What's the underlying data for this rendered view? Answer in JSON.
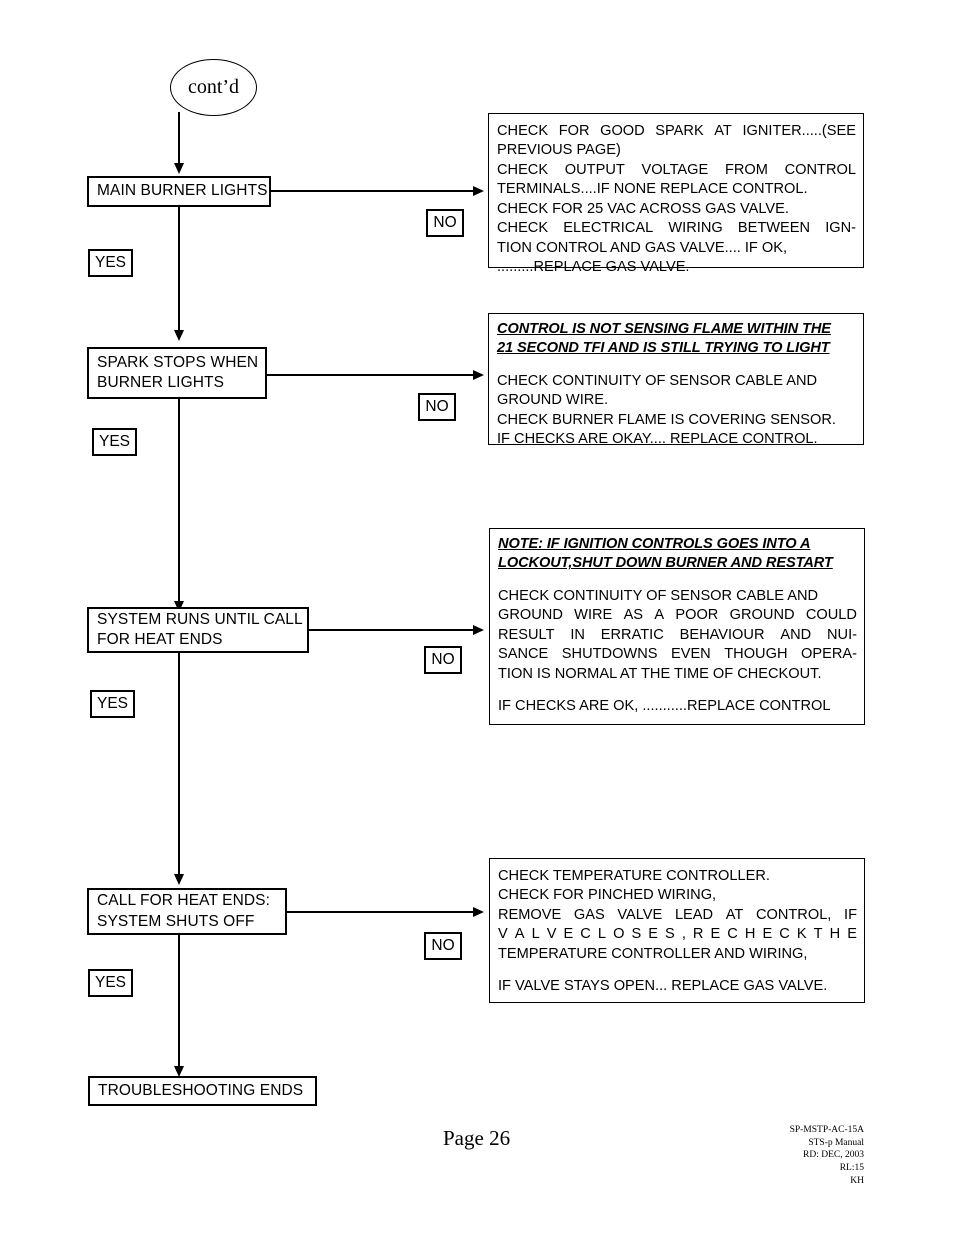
{
  "document": {
    "page_label": "Page 26",
    "meta_lines": [
      "SP-MSTP-AC-15A",
      "STS-p Manual",
      "RD: DEC, 2003",
      "RL:15",
      "KH"
    ]
  },
  "flow": {
    "start_node": {
      "label": "cont’d"
    },
    "steps": [
      {
        "id": "main-burner-lights",
        "lines": [
          "MAIN BURNER LIGHTS"
        ],
        "yes_label": "YES",
        "no_label": "NO"
      },
      {
        "id": "spark-stops-when-burner-lights",
        "lines": [
          "SPARK STOPS WHEN",
          "BURNER LIGHTS"
        ],
        "yes_label": "YES",
        "no_label": "NO"
      },
      {
        "id": "system-runs-until-call-for-heat-ends",
        "lines": [
          "SYSTEM RUNS UNTIL CALL",
          "FOR HEAT ENDS"
        ],
        "yes_label": "YES",
        "no_label": "NO"
      },
      {
        "id": "call-for-heat-ends-system-shuts-off",
        "lines": [
          "CALL FOR HEAT ENDS:",
          "SYSTEM SHUTS OFF"
        ],
        "yes_label": "YES",
        "no_label": "NO"
      }
    ],
    "end_node": {
      "label": "TROUBLESHOOTING ENDS"
    }
  },
  "panels": [
    {
      "id": "spark-igniter-checks",
      "header": null,
      "header2": null,
      "lines": [
        {
          "text": "CHECK  FOR  GOOD  SPARK  AT  IGNITER.....(SEE",
          "justify": true,
          "words": [
            "CHECK",
            "FOR",
            "GOOD",
            "SPARK",
            "AT",
            "IGNITER.....(SEE"
          ]
        },
        {
          "text": "PREVIOUS PAGE)",
          "justify": false
        },
        {
          "text": "CHECK  OUTPUT  VOLTAGE  FROM  CONTROL",
          "justify": true,
          "words": [
            "CHECK",
            "OUTPUT",
            "VOLTAGE",
            "FROM",
            "CONTROL"
          ]
        },
        {
          "text": "TERMINALS....IF NONE REPLACE CONTROL.",
          "justify": false
        },
        {
          "text": "CHECK FOR 25 VAC  ACROSS GAS VALVE.",
          "justify": false
        },
        {
          "text": "CHECK  ELECTRICAL  WIRING  BETWEEN  IGN-",
          "justify": true,
          "words": [
            "CHECK",
            "ELECTRICAL",
            "WIRING",
            "BETWEEN",
            "IGN-"
          ]
        },
        {
          "text": "TION  CONTROL AND GAS VALVE.... IF OK,",
          "justify": false
        },
        {
          "text": ".........REPLACE GAS VALVE.",
          "justify": false
        }
      ]
    },
    {
      "id": "flame-sensing-checks",
      "header": "CONTROL IS NOT SENSING FLAME WITHIN THE",
      "header2": "21 SECOND TFI AND IS STILL TRYING TO LIGHT",
      "lines": [
        {
          "text": "CHECK CONTINUITY OF SENSOR CABLE AND",
          "justify": false
        },
        {
          "text": "GROUND WIRE.",
          "justify": false
        },
        {
          "text": "CHECK BURNER FLAME IS COVERING SENSOR.",
          "justify": false
        },
        {
          "text": "IF CHECKS ARE OKAY.... REPLACE CONTROL.",
          "justify": false
        }
      ]
    },
    {
      "id": "ground-lockout-checks",
      "header": "NOTE: IF IGNITION CONTROLS GOES INTO  A",
      "header2": "LOCKOUT,SHUT DOWN BURNER AND RESTART",
      "lines": [
        {
          "text": "CHECK CONTINUITY OF SENSOR CABLE AND",
          "justify": false
        },
        {
          "text": "GROUND  WIRE  AS  A  POOR  GROUND  COULD",
          "justify": true,
          "words": [
            "GROUND",
            "WIRE",
            "AS",
            "A",
            "POOR",
            "GROUND",
            "COULD"
          ]
        },
        {
          "text": "RESULT  IN  ERRATIC  BEHAVIOUR  AND  NUI-",
          "justify": true,
          "words": [
            "RESULT",
            "IN",
            "ERRATIC",
            "BEHAVIOUR",
            "AND",
            "NUI-"
          ]
        },
        {
          "text": "SANCE  SHUTDOWNS  EVEN  THOUGH  OPERA-",
          "justify": true,
          "words": [
            "SANCE",
            "SHUTDOWNS",
            "EVEN",
            "THOUGH",
            "OPERA-"
          ]
        },
        {
          "text": "TION IS NORMAL AT THE TIME OF CHECKOUT.",
          "justify": false
        },
        {
          "text": "",
          "justify": false
        },
        {
          "text": "IF CHECKS ARE OK, ...........REPLACE CONTROL",
          "justify": false
        }
      ]
    },
    {
      "id": "temperature-controller-checks",
      "header": null,
      "header2": null,
      "lines": [
        {
          "text": "CHECK TEMPERATURE CONTROLLER.",
          "justify": false
        },
        {
          "text": "CHECK FOR PINCHED WIRING,",
          "justify": false
        },
        {
          "text": "REMOVE  GAS  VALVE  LEAD  AT  CONTROL,  IF",
          "justify": true,
          "words": [
            "REMOVE",
            "GAS",
            "VALVE",
            "LEAD",
            "AT",
            "CONTROL,",
            "IF"
          ]
        },
        {
          "text": "V A L V E    C L O S E S ,    R E C H E C K    T H E",
          "justify": true,
          "words": [
            "V",
            "A",
            "L",
            "V",
            "E",
            "C",
            "L",
            "O",
            "S",
            "E",
            "S",
            ",",
            "R",
            "E",
            "C",
            "H",
            "E",
            "C",
            "K",
            "T",
            "H",
            "E"
          ]
        },
        {
          "text": "TEMPERATURE CONTROLLER AND WIRING,",
          "justify": false
        },
        {
          "text": "",
          "justify": false
        },
        {
          "text": "IF VALVE STAYS OPEN... REPLACE GAS VALVE.",
          "justify": false
        }
      ]
    }
  ]
}
